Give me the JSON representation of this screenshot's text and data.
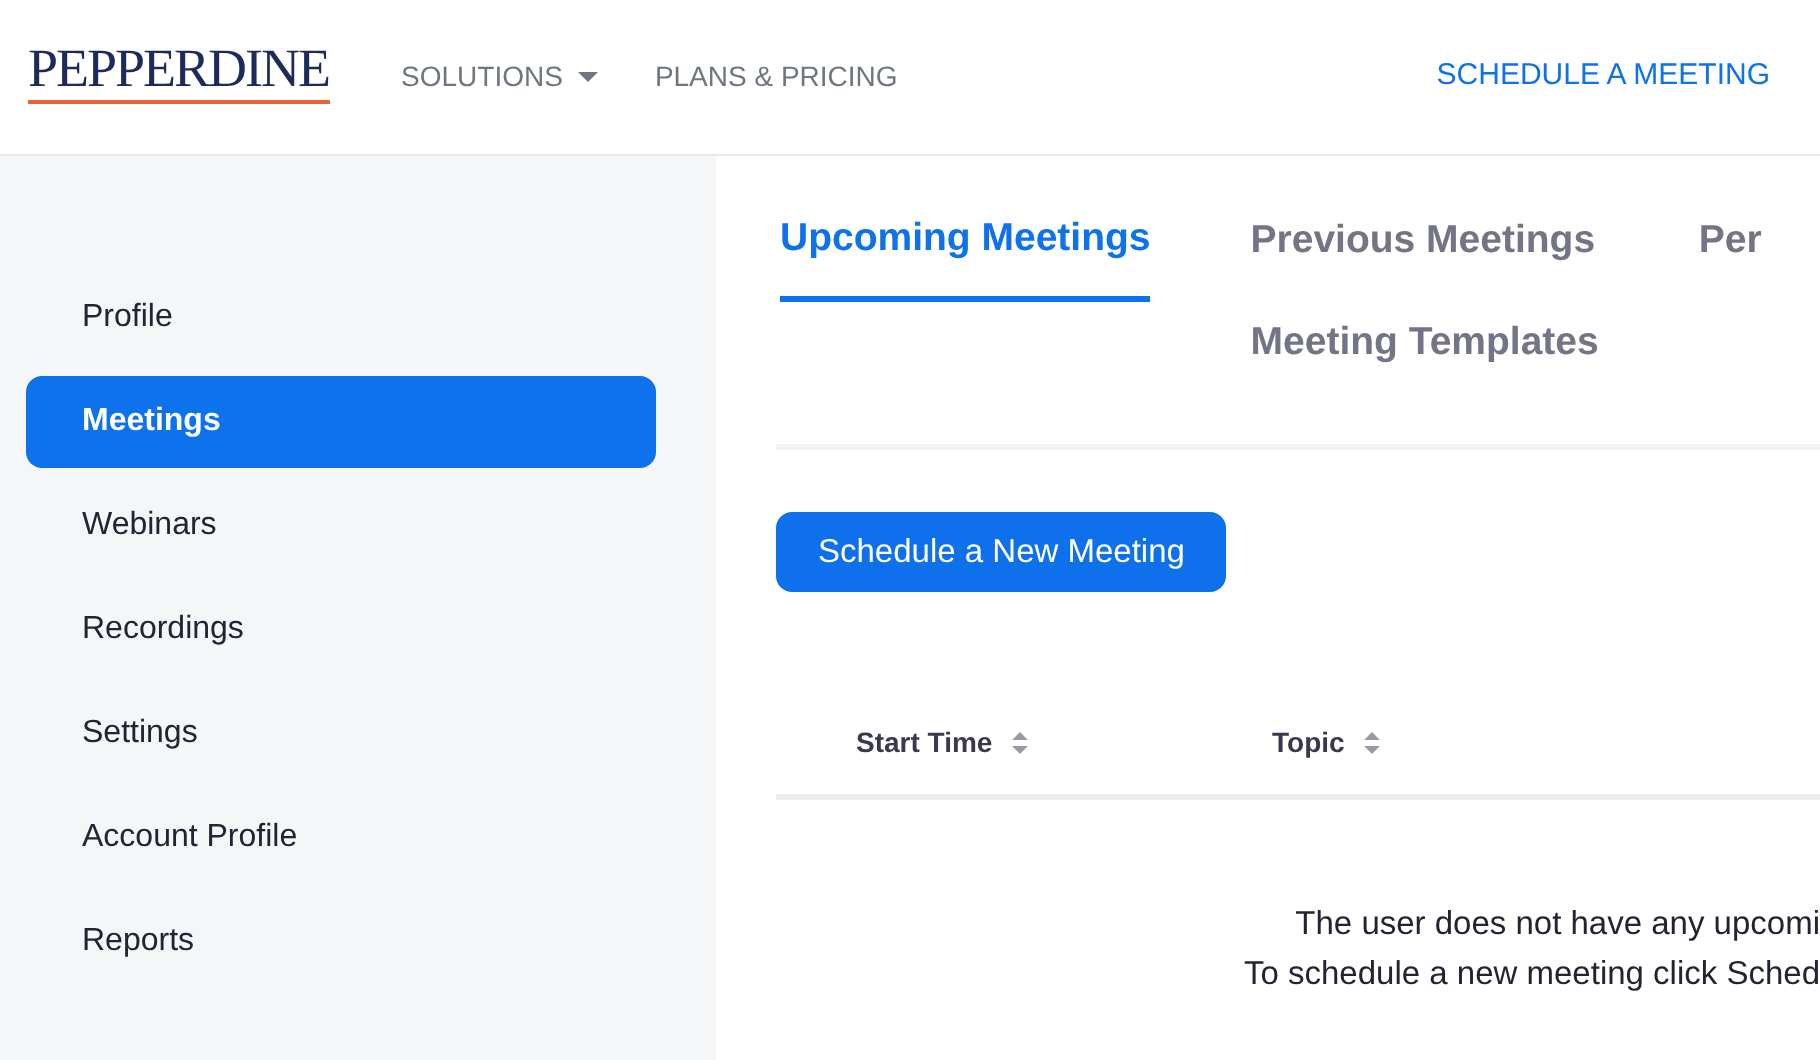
{
  "header": {
    "logo": "PEPPERDINE",
    "nav": [
      {
        "label": "SOLUTIONS",
        "dropdown": true
      },
      {
        "label": "PLANS & PRICING",
        "dropdown": false
      }
    ],
    "right_link": "SCHEDULE A MEETING"
  },
  "sidebar": {
    "items": [
      {
        "label": "Profile",
        "selected": false
      },
      {
        "label": "Meetings",
        "selected": true
      },
      {
        "label": "Webinars",
        "selected": false
      },
      {
        "label": "Recordings",
        "selected": false
      },
      {
        "label": "Settings",
        "selected": false
      },
      {
        "label": "Account Profile",
        "selected": false
      },
      {
        "label": "Reports",
        "selected": false
      }
    ]
  },
  "tabs": [
    {
      "label": "Upcoming Meetings",
      "selected": true
    },
    {
      "label": "Previous Meetings",
      "selected": false
    },
    {
      "label": "Per",
      "selected": false
    },
    {
      "label": "Meeting Templates",
      "selected": false
    }
  ],
  "schedule_button": "Schedule a New Meeting",
  "table": {
    "columns": [
      {
        "label": "Start Time",
        "sortable": true
      },
      {
        "label": "Topic",
        "sortable": true
      }
    ]
  },
  "empty_message": [
    "The user does not have any upcomi",
    "To schedule a new meeting click Sched"
  ]
}
